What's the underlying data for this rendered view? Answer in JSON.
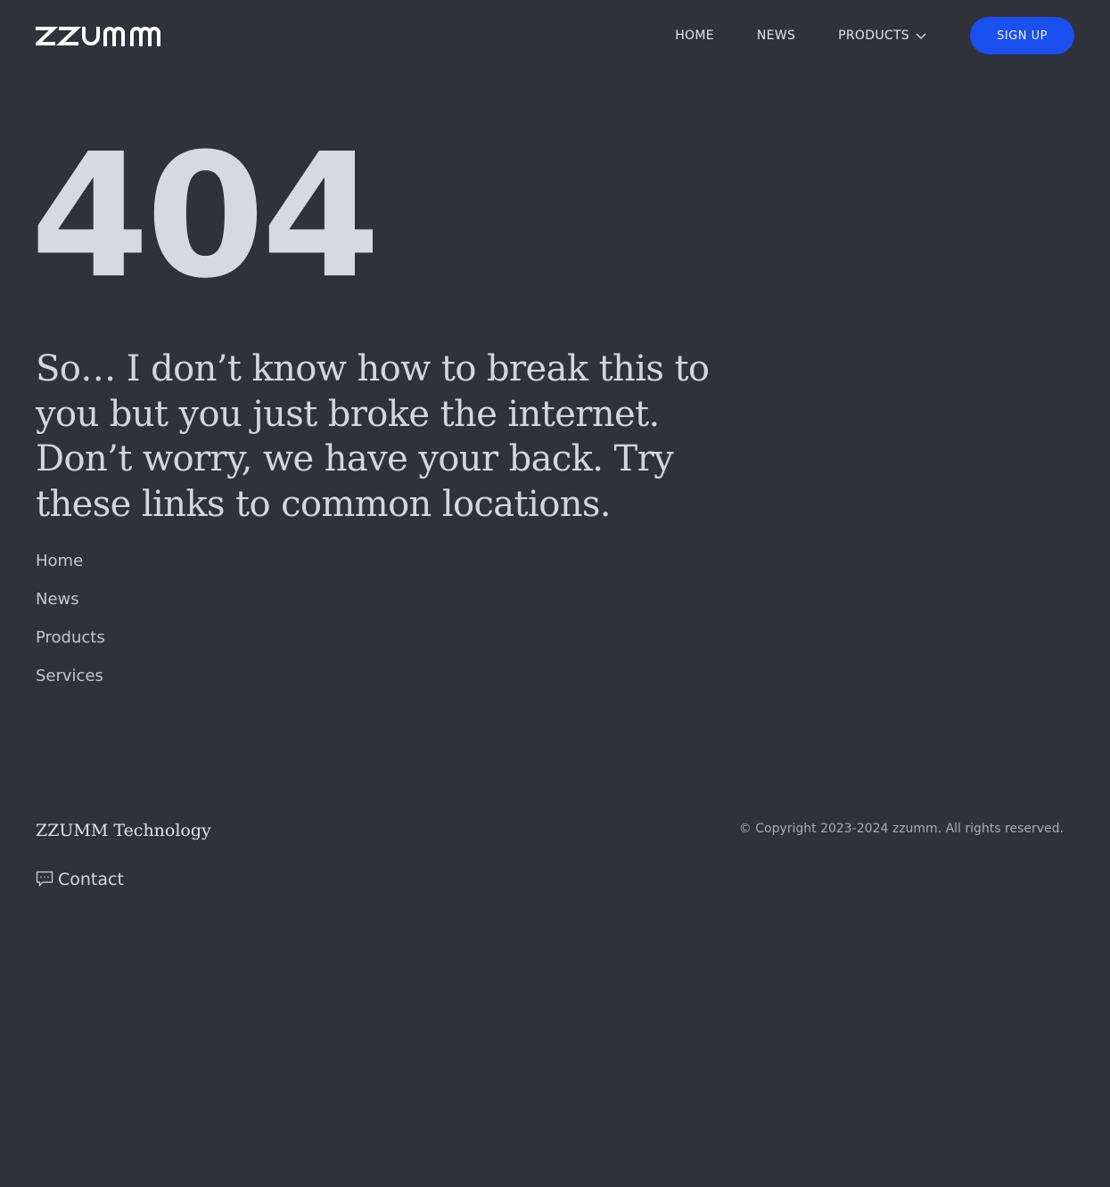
{
  "header": {
    "logo_text": "zzumm",
    "nav": {
      "home": "HOME",
      "news": "NEWS",
      "products": "PRODUCTS",
      "signup": "SIGN UP"
    }
  },
  "main": {
    "error_code": "404",
    "message": "So… I don’t know how to break this to you but you just broke the internet. Don’t worry, we have your back. Try these links to common locations.",
    "links": [
      "Home",
      "News",
      "Products",
      "Services"
    ]
  },
  "footer": {
    "brand": "ZZUMM Technology",
    "copyright": "© Copyright 2023-2024 zzumm. All rights reserved.",
    "contact": "Contact"
  },
  "colors": {
    "background": "#30323b",
    "accent": "#1a4ff0",
    "text": "#d5d8df"
  },
  "icons": [
    "chevron-down-icon",
    "chat-icon"
  ]
}
